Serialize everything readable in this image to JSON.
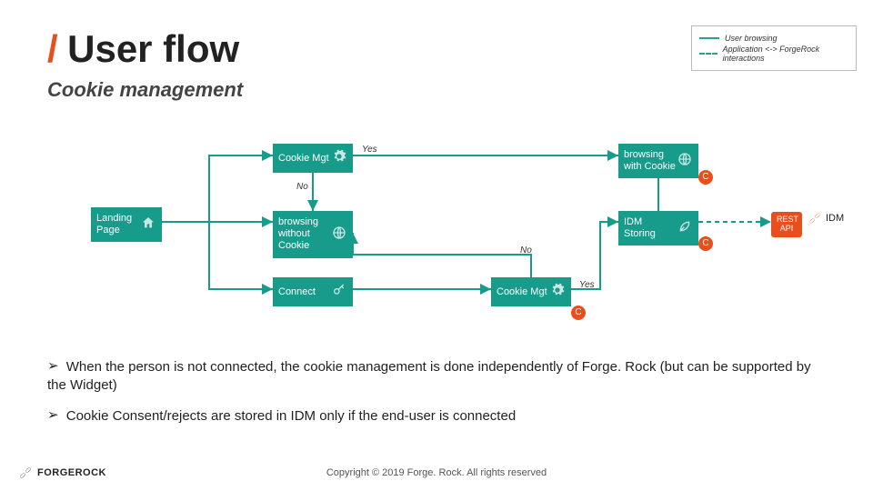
{
  "header": {
    "slash": "/",
    "title": "User flow",
    "subtitle": "Cookie management"
  },
  "legend": {
    "item1": "User browsing",
    "item2": "Application <-> ForgeRock interactions"
  },
  "nodes": {
    "landing": "Landing Page",
    "cookie_mgt_top": "Cookie Mgt",
    "browsing_without": "browsing without Cookie",
    "connect": "Connect",
    "cookie_mgt_mid": "Cookie Mgt",
    "browsing_with": "browsing with Cookie",
    "idm_storing": "IDM Storing",
    "rest_api": "REST API",
    "idm": "IDM"
  },
  "edges": {
    "yes1": "Yes",
    "no1": "No",
    "no2": "No",
    "yes2": "Yes",
    "c": "C"
  },
  "bullets": {
    "b1": "When the person is not connected, the cookie management is done independently of Forge. Rock (but can be supported by the Widget)",
    "b2": "Cookie Consent/rejects are stored in IDM only if the end-user is connected"
  },
  "footer": {
    "brand": "FORGEROCK",
    "copyright": "Copyright © 2019 Forge. Rock. All rights reserved"
  }
}
